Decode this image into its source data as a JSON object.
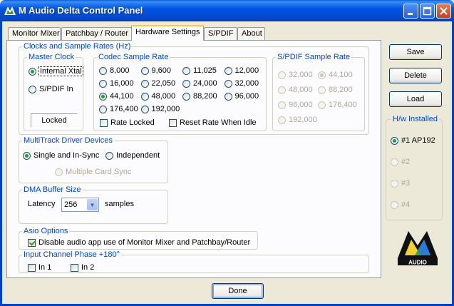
{
  "window": {
    "title": "M Audio Delta Control Panel"
  },
  "tabs": [
    "Monitor Mixer",
    "Patchbay / Router",
    "Hardware Settings",
    "S/PDIF",
    "About"
  ],
  "clocks": {
    "group_label": "Clocks and Sample Rates (Hz)",
    "master_clock": {
      "label": "Master Clock",
      "internal": "Internal Xtal",
      "spdif_in": "S/PDIF In",
      "status": "Locked"
    },
    "codec": {
      "label": "Codec Sample Rate",
      "rates": [
        "8,000",
        "9,600",
        "11,025",
        "12,000",
        "16,000",
        "22,050",
        "24,000",
        "32,000",
        "44,100",
        "48,000",
        "88,200",
        "96,000",
        "176,400",
        "192,000"
      ],
      "selected": "44,100",
      "rate_locked": "Rate Locked",
      "reset_rate": "Reset Rate When Idle"
    },
    "spdif": {
      "label": "S/PDIF Sample Rate",
      "rates": [
        "32,000",
        "44,100",
        "48,000",
        "88,200",
        "96,000",
        "176,400",
        "192,000"
      ],
      "selected": "44,100"
    }
  },
  "multitrack": {
    "label": "MultiTrack Driver Devices",
    "single": "Single and In-Sync",
    "independent": "Independent",
    "multiple": "Multiple Card Sync"
  },
  "dma": {
    "label": "DMA Buffer Size",
    "latency_label": "Latency",
    "latency_value": "256",
    "unit": "samples"
  },
  "asio": {
    "label": "Asio Options",
    "disable": "Disable audio app use of Monitor Mixer and Patchbay/Router"
  },
  "phase": {
    "label": "Input Channel Phase +180°",
    "in1": "In 1",
    "in2": "In 2"
  },
  "side": {
    "save": "Save",
    "delete": "Delete",
    "load": "Load",
    "hw_label": "H/w Installed",
    "devices": [
      "#1 AP192",
      "#2",
      "#3",
      "#4"
    ]
  },
  "logo": {
    "text": "AUDIO"
  },
  "done": "Done",
  "colors": {
    "titlebar": "#0054e3",
    "group_label": "#0046d5",
    "radio_dot": "#21a121"
  }
}
